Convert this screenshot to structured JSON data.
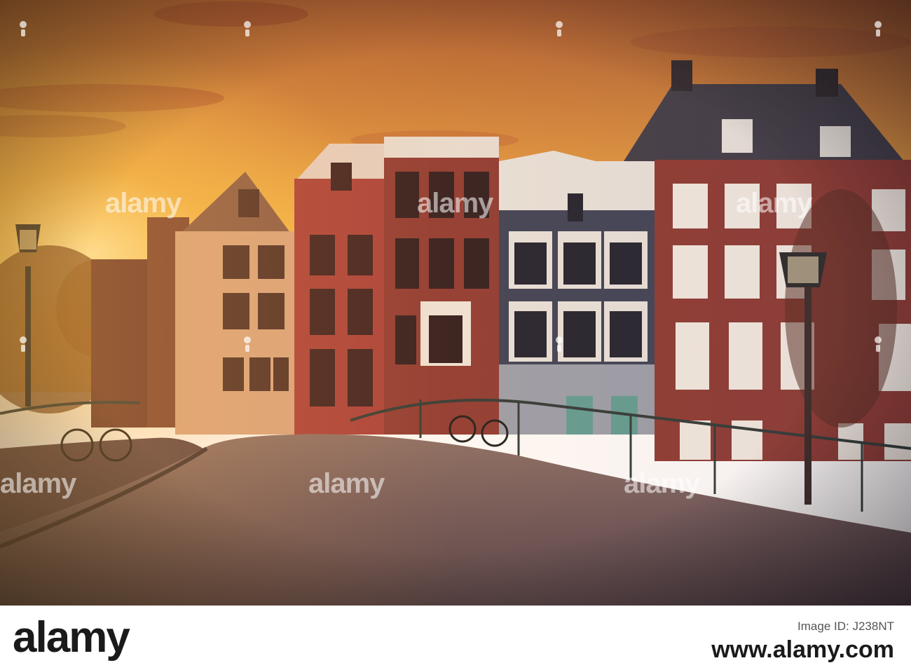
{
  "photo": {
    "description_colors": {
      "sky_top": "#b8703a",
      "sky_glow": "#f6c04a",
      "street": "#6e5a5c"
    }
  },
  "watermark": {
    "text": "alamy"
  },
  "footer": {
    "logo": "alamy",
    "image_id_label": "Image ID: J238NT",
    "url": "www.alamy.com"
  }
}
